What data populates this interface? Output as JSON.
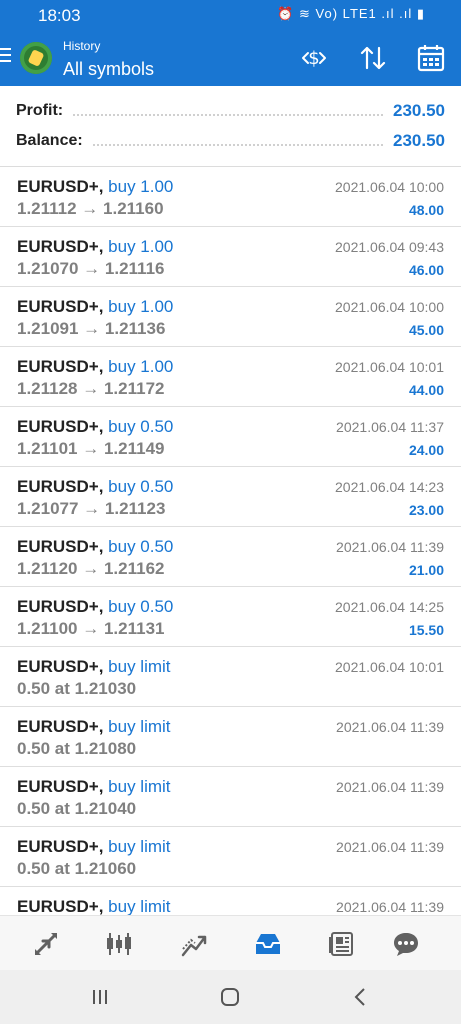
{
  "status_bar": {
    "time": "18:03",
    "icons_text": "⏰ ≋ Vo) LTE1 .ıl .ıl ▮"
  },
  "header": {
    "subtitle": "History",
    "title": "All symbols"
  },
  "summary": {
    "profit_label": "Profit:",
    "profit_value": "230.50",
    "balance_label": "Balance:",
    "balance_value": "230.50"
  },
  "rows": [
    {
      "symbol": "EURUSD+,",
      "side": "buy 1.00",
      "prices": "1.21112 → 1.21160",
      "time": "2021.06.04 10:00",
      "profit": "48.00"
    },
    {
      "symbol": "EURUSD+,",
      "side": "buy 1.00",
      "prices": "1.21070 → 1.21116",
      "time": "2021.06.04 09:43",
      "profit": "46.00"
    },
    {
      "symbol": "EURUSD+,",
      "side": "buy 1.00",
      "prices": "1.21091 → 1.21136",
      "time": "2021.06.04 10:00",
      "profit": "45.00"
    },
    {
      "symbol": "EURUSD+,",
      "side": "buy 1.00",
      "prices": "1.21128 → 1.21172",
      "time": "2021.06.04 10:01",
      "profit": "44.00"
    },
    {
      "symbol": "EURUSD+,",
      "side": "buy 0.50",
      "prices": "1.21101 → 1.21149",
      "time": "2021.06.04 11:37",
      "profit": "24.00"
    },
    {
      "symbol": "EURUSD+,",
      "side": "buy 0.50",
      "prices": "1.21077 → 1.21123",
      "time": "2021.06.04 14:23",
      "profit": "23.00"
    },
    {
      "symbol": "EURUSD+,",
      "side": "buy 0.50",
      "prices": "1.21120 → 1.21162",
      "time": "2021.06.04 11:39",
      "profit": "21.00"
    },
    {
      "symbol": "EURUSD+,",
      "side": "buy 0.50",
      "prices": "1.21100 → 1.21131",
      "time": "2021.06.04 14:25",
      "profit": "15.50"
    },
    {
      "symbol": "EURUSD+,",
      "side": "buy limit",
      "prices": "0.50 at 1.21030",
      "time": "2021.06.04 10:01",
      "profit": ""
    },
    {
      "symbol": "EURUSD+,",
      "side": "buy limit",
      "prices": "0.50 at 1.21080",
      "time": "2021.06.04 11:39",
      "profit": ""
    },
    {
      "symbol": "EURUSD+,",
      "side": "buy limit",
      "prices": "0.50 at 1.21040",
      "time": "2021.06.04 11:39",
      "profit": ""
    },
    {
      "symbol": "EURUSD+,",
      "side": "buy limit",
      "prices": "0.50 at 1.21060",
      "time": "2021.06.04 11:39",
      "profit": ""
    },
    {
      "symbol": "EURUSD+,",
      "side": "buy limit",
      "prices": "",
      "time": "2021.06.04 11:39",
      "profit": ""
    }
  ],
  "tabs": [
    {
      "icon": "quotes-icon",
      "active": false
    },
    {
      "icon": "chart-icon",
      "active": false
    },
    {
      "icon": "trade-icon",
      "active": false
    },
    {
      "icon": "history-icon",
      "active": true
    },
    {
      "icon": "news-icon",
      "active": false
    },
    {
      "icon": "messages-icon",
      "active": false
    }
  ],
  "colors": {
    "accent": "#1976d2",
    "inactive_icon": "#616161"
  }
}
